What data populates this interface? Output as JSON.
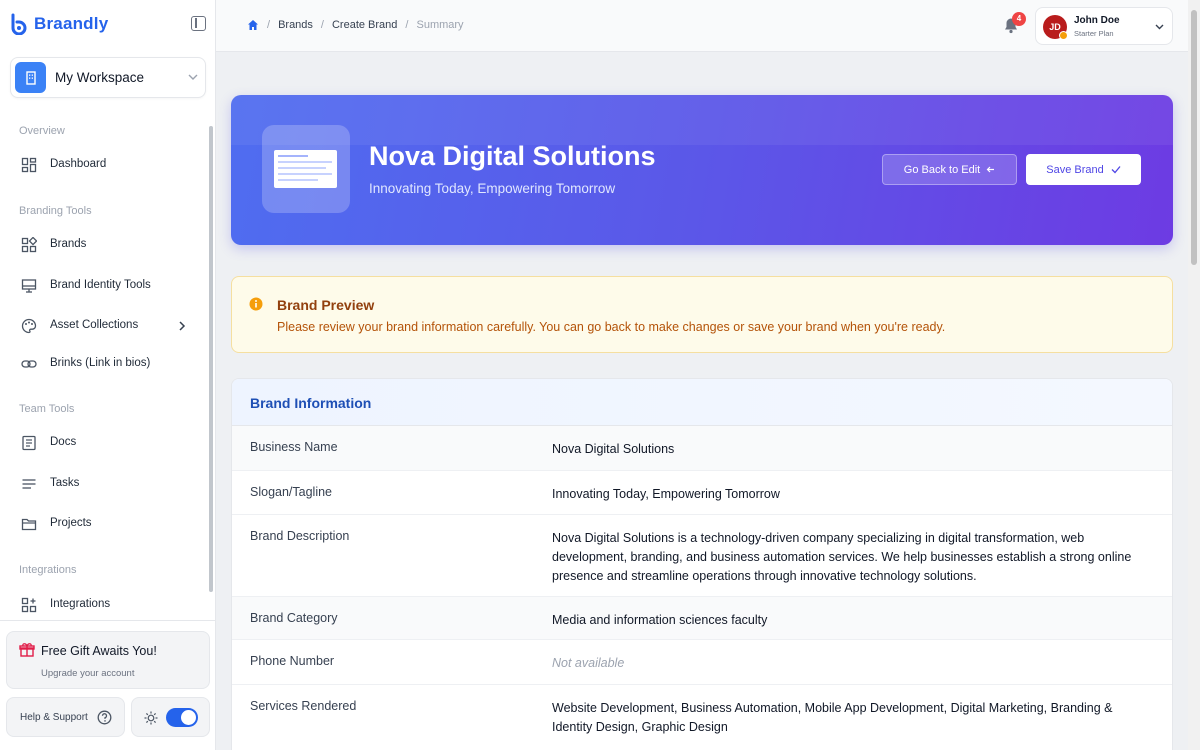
{
  "app": {
    "name": "Braandly"
  },
  "workspace": {
    "label": "My Workspace"
  },
  "sidebar": {
    "sections": [
      {
        "title": "Overview"
      },
      {
        "title": "Branding Tools"
      },
      {
        "title": "Team Tools"
      },
      {
        "title": "Integrations"
      }
    ],
    "items": [
      {
        "label": "Dashboard",
        "icon": "dashboard-icon"
      },
      {
        "label": "Brands",
        "icon": "brands-icon"
      },
      {
        "label": "Brand Identity Tools",
        "icon": "monitor-icon"
      },
      {
        "label": "Asset Collections",
        "icon": "palette-icon"
      },
      {
        "label": "Brinks (Link in bios)",
        "icon": "link-icon"
      },
      {
        "label": "Docs",
        "icon": "document-icon"
      },
      {
        "label": "Tasks",
        "icon": "list-icon"
      },
      {
        "label": "Projects",
        "icon": "folder-icon"
      },
      {
        "label": "Integrations",
        "icon": "integrations-icon"
      }
    ],
    "gift": {
      "title": "Free Gift Awaits You!",
      "subtitle": "Upgrade your account"
    },
    "help_label": "Help & Support"
  },
  "breadcrumb": {
    "items": [
      "Brands",
      "Create Brand"
    ],
    "current": "Summary"
  },
  "notifications": {
    "count": "4"
  },
  "user": {
    "initials": "JD",
    "name": "John Doe",
    "plan": "Starter Plan"
  },
  "hero": {
    "title": "Nova Digital Solutions",
    "slogan": "Innovating Today, Empowering Tomorrow",
    "back_label": "Go Back to Edit",
    "save_label": "Save Brand"
  },
  "alert": {
    "title": "Brand Preview",
    "text": "Please review your brand information carefully. You can go back to make changes or save your brand when you're ready."
  },
  "info": {
    "title": "Brand Information",
    "rows": [
      {
        "label": "Business Name",
        "value": "Nova Digital Solutions"
      },
      {
        "label": "Slogan/Tagline",
        "value": "Innovating Today, Empowering Tomorrow"
      },
      {
        "label": "Brand Description",
        "value": "Nova Digital Solutions is a technology-driven company specializing in digital transformation, web development, branding, and business automation services. We help businesses establish a strong online presence and streamline operations through innovative technology solutions."
      },
      {
        "label": "Brand Category",
        "value": "Media and information sciences faculty"
      },
      {
        "label": "Phone Number",
        "value": "Not available"
      },
      {
        "label": "Services Rendered",
        "value": "Website Development, Business Automation, Mobile App Development, Digital Marketing, Branding & Identity Design, Graphic Design"
      }
    ]
  },
  "colors": {
    "accent": "#2563eb",
    "hero_start": "#4f6df0",
    "hero_end": "#6d3be3",
    "alert_bg": "#fefbea"
  }
}
